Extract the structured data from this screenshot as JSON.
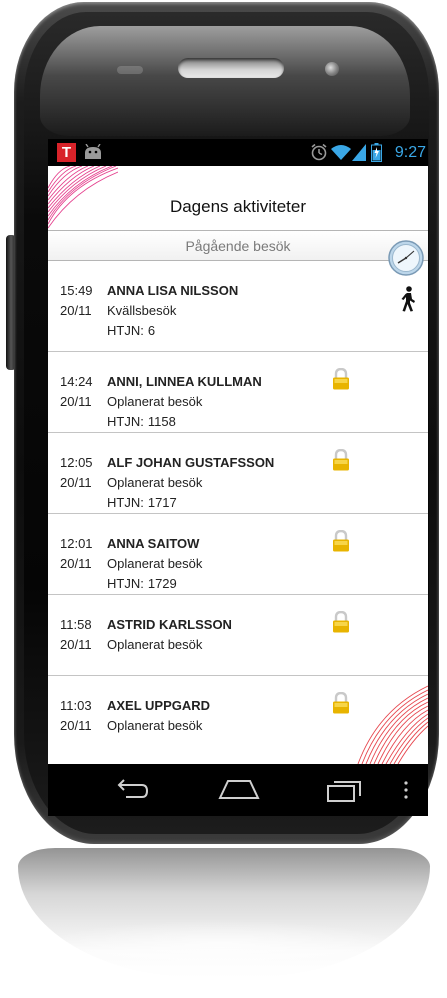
{
  "status_bar": {
    "app_badge": "T",
    "time": "9:27",
    "accent_color": "#3aa7e6",
    "icons": [
      "app-t-icon",
      "android-icon",
      "alarm-icon",
      "wifi-icon",
      "signal-icon",
      "battery-icon"
    ]
  },
  "header": {
    "title": "Dagens aktiviteter"
  },
  "subheader": {
    "label": "Pågående besök",
    "button_icon": "clock-icon"
  },
  "visits": [
    {
      "time": "15:49",
      "date": "20/11",
      "name": "ANNA LISA NILSSON",
      "type": "Kvällsbesök",
      "htjn_label": "HTJN:",
      "htjn": "6",
      "status_icon": "walking-person-icon"
    },
    {
      "time": "14:24",
      "date": "20/11",
      "name": "ANNI, LINNEA KULLMAN",
      "type": "Oplanerat besök",
      "htjn_label": "HTJN:",
      "htjn": "1158",
      "status_icon": "lock-icon"
    },
    {
      "time": "12:05",
      "date": "20/11",
      "name": "ALF JOHAN GUSTAFSSON",
      "type": "Oplanerat besök",
      "htjn_label": "HTJN:",
      "htjn": "1717",
      "status_icon": "lock-icon"
    },
    {
      "time": "12:01",
      "date": "20/11",
      "name": "ANNA SAITOW",
      "type": "Oplanerat besök",
      "htjn_label": "HTJN:",
      "htjn": "1729",
      "status_icon": "lock-icon"
    },
    {
      "time": "11:58",
      "date": "20/11",
      "name": "ASTRID KARLSSON",
      "type": "Oplanerat besök",
      "status_icon": "lock-icon"
    },
    {
      "time": "11:03",
      "date": "20/11",
      "name": "AXEL UPPGARD",
      "type": "Oplanerat besök",
      "status_icon": "lock-icon"
    }
  ],
  "nav_bar": {
    "icons": [
      "back-icon",
      "home-icon",
      "recent-apps-icon",
      "overflow-menu-icon"
    ]
  },
  "colors": {
    "brand_pink": "#e0207a",
    "lock_gold": "#e8b400",
    "app_badge_red": "#d8232a"
  }
}
